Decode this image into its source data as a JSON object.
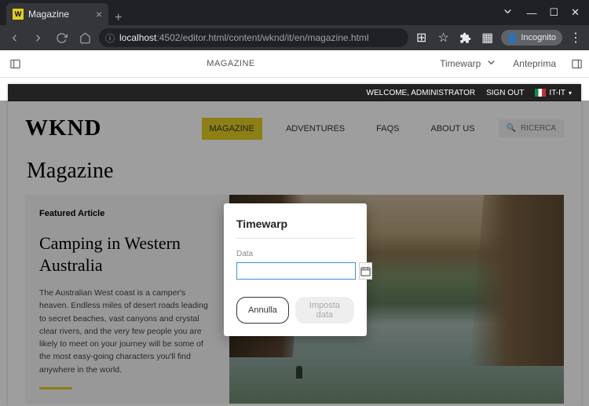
{
  "browser": {
    "tab_title": "Magazine",
    "url_host": "localhost",
    "url_port": ":4502",
    "url_path": "/editor.html/content/wknd/it/en/magazine.html",
    "incognito_label": "Incognito"
  },
  "editor": {
    "page_label": "MAGAZINE",
    "mode_label": "Timewarp",
    "preview_label": "Anteprima"
  },
  "topbar": {
    "welcome": "WELCOME, ADMINISTRATOR",
    "signout": "SIGN OUT",
    "language": "IT-IT"
  },
  "site": {
    "brand": "WKND",
    "nav": [
      {
        "label": "MAGAZINE",
        "active": true
      },
      {
        "label": "ADVENTURES",
        "active": false
      },
      {
        "label": "FAQS",
        "active": false
      },
      {
        "label": "ABOUT US",
        "active": false
      }
    ],
    "search_placeholder": "RICERCA"
  },
  "page": {
    "h1": "Magazine",
    "featured_label": "Featured Article",
    "article_title": "Camping in Western Australia",
    "article_body": "The Australian West coast is a camper's heaven. Endless miles of desert roads leading to secret beaches, vast canyons and crystal clear rivers, and the very few people you are likely to meet on your journey will be some of the most easy-going characters you'll find anywhere in the world."
  },
  "modal": {
    "title": "Timewarp",
    "date_label": "Data",
    "date_value": "",
    "cancel_label": "Annulla",
    "submit_label": "Imposta data"
  }
}
